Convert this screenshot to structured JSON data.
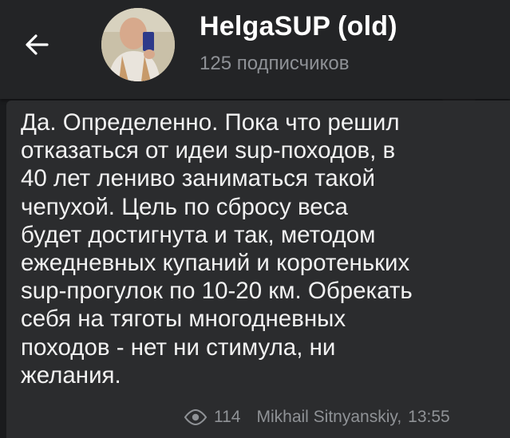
{
  "header": {
    "title": "HelgaSUP (old)",
    "subscribers": "125 подписчиков"
  },
  "message": {
    "text": "Да. Определенно. Пока что решил\nотказаться от идеи sup-походов, в\n40 лет лениво заниматься такой\nчепухой. Цель по сбросу веса\nбудет достигнута и так, методом\nежедневных купаний и коротеньких\nsup-прогулок по 10-20 км. Обрекать\nсебя на тяготы многодневных\nпоходов - нет ни стимула, ни\nжелания.",
    "views": "114",
    "author": "Mikhail Sitnyanskiy,",
    "time": "13:55"
  },
  "icons": {
    "back": "arrow-left-icon",
    "views": "eye-icon"
  },
  "colors": {
    "header_bg": "#232426",
    "bubble_bg": "#2b2c2e",
    "text": "#f1f1f1",
    "muted": "#8e9196"
  }
}
